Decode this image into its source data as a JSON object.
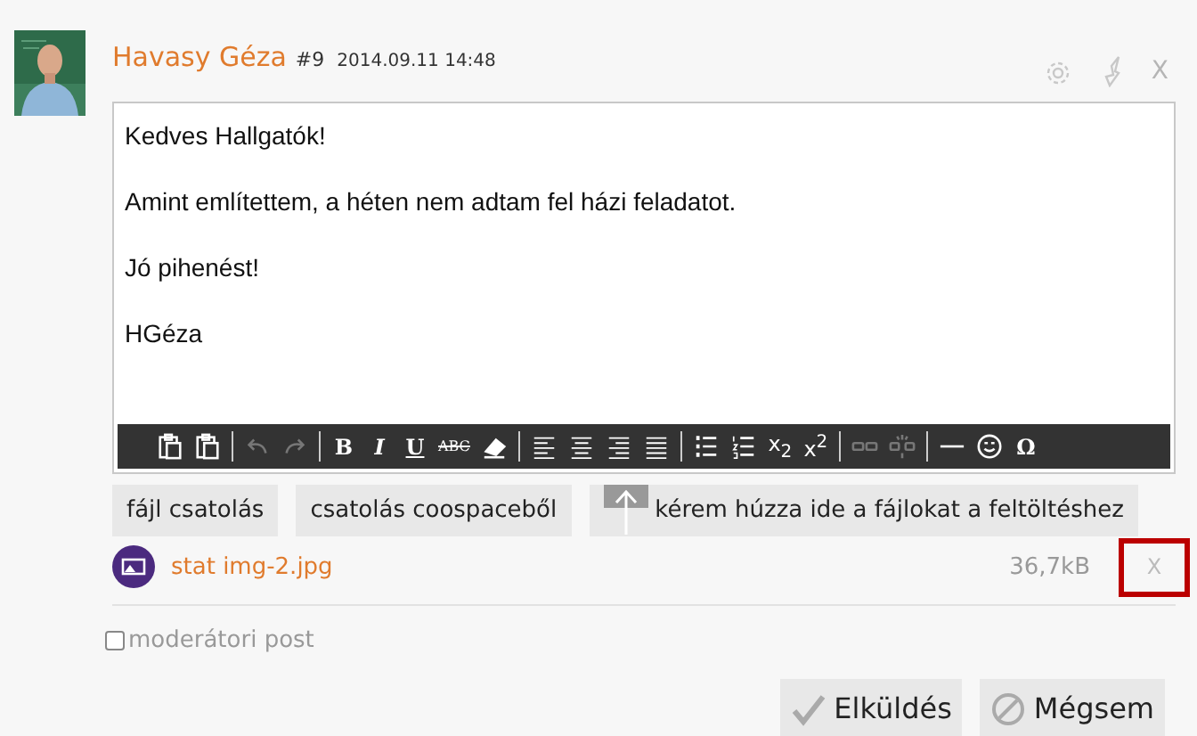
{
  "post": {
    "author": "Havasy Géza",
    "number": "#9",
    "timestamp": "2014.09.11 14:48"
  },
  "header_actions": [
    {
      "kind": "settings"
    },
    {
      "kind": "flag"
    },
    {
      "kind": "close",
      "label": "X"
    }
  ],
  "editor": {
    "paragraphs": [
      "Kedves Hallgatók!",
      "Amint említettem, a héten nem adtam fel házi feladatot.",
      "Jó pihenést!",
      "HGéza"
    ]
  },
  "toolbar": [
    [
      {
        "kind": "pastetext",
        "disabled": false
      },
      {
        "kind": "pasteword",
        "disabled": false
      }
    ],
    [
      {
        "kind": "undo",
        "disabled": true
      },
      {
        "kind": "redo",
        "disabled": true
      }
    ],
    [
      {
        "kind": "bold",
        "label": "B",
        "disabled": false
      },
      {
        "kind": "italic",
        "label": "I",
        "disabled": false
      },
      {
        "kind": "underline",
        "label": "U",
        "disabled": false
      },
      {
        "kind": "strike",
        "label": "ABC",
        "disabled": false
      },
      {
        "kind": "eraser",
        "disabled": false
      }
    ],
    [
      {
        "kind": "alignleft",
        "disabled": false
      },
      {
        "kind": "aligncenter",
        "disabled": false
      },
      {
        "kind": "alignright",
        "disabled": false
      },
      {
        "kind": "justify",
        "disabled": false
      }
    ],
    [
      {
        "kind": "bullets",
        "disabled": false
      },
      {
        "kind": "numbering",
        "disabled": false
      },
      {
        "kind": "subscript",
        "label": "x$_{2}$",
        "disabled": false
      },
      {
        "kind": "superscript",
        "label": "x$^{2}$",
        "disabled": false
      }
    ],
    [
      {
        "kind": "link",
        "disabled": true
      },
      {
        "kind": "unlink",
        "disabled": true
      }
    ],
    [
      {
        "kind": "rule",
        "disabled": false
      },
      {
        "kind": "smiley",
        "disabled": false
      },
      {
        "kind": "symbol",
        "label": "Ω",
        "disabled": false
      }
    ]
  ],
  "attach_buttons": [
    {
      "label": "fájl csatolás",
      "kind": "plain"
    },
    {
      "label": "csatolás coospaceből",
      "kind": "plain"
    },
    {
      "label": "kérem húzza ide a fájlokat a feltöltéshez",
      "kind": "upload"
    }
  ],
  "attachments": [
    {
      "name": "stat img-2.jpg",
      "size": "36,7kB",
      "remove": "X",
      "highlighted": true
    }
  ],
  "moderator_post": {
    "label": "moderátori post",
    "checked": false
  },
  "actions": [
    {
      "label": "Elküldés",
      "kind": "send"
    },
    {
      "label": "Mégsem",
      "kind": "cancel"
    }
  ]
}
